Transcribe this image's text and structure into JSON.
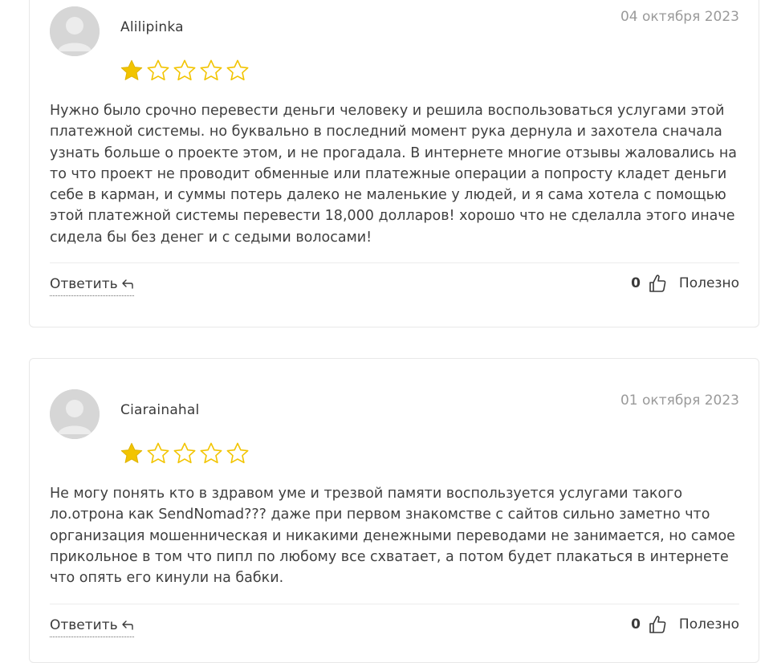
{
  "colors": {
    "star_filled": "#f2c400",
    "star_outline": "#f2c400",
    "date": "#9a9a9a",
    "text": "#3f3f3f"
  },
  "reviews": [
    {
      "author": "Alilipinka",
      "date": "04 октября 2023",
      "rating": 1,
      "max_rating": 5,
      "text": "Нужно было срочно перевести деньги человеку и решила воспользоваться услугами этой платежной системы. но буквально в последний момент рука дернула и захотела сначала узнать больше о проекте этом, и не прогадала. В интернете многие отзывы жаловались на то что проект не проводит обменные или платежные операции а попросту кладет деньги себе в карман, и суммы потерь далеко не маленькие у людей, и я сама хотела с помощью этой платежной системы перевести 18,000 долларов! хорошо что не сделалла этого иначе сидела бы без денег и с седыми волосами!",
      "reply_label": "Ответить",
      "reply_icon": "reply-arrow-icon",
      "likes": "0",
      "useful_label": "Полезно",
      "like_icon": "thumbs-up-icon"
    },
    {
      "author": "Ciarainahal",
      "date": "01 октября 2023",
      "rating": 1,
      "max_rating": 5,
      "text": "Не могу понять кто в здравом уме и трезвой памяти воспользуется услугами такого ло.отрона как SendNomad??? даже при первом знакомстве с сайтов сильно заметно что организация мошенническая и никакими денежными переводами не занимается, но самое прикольное в том что пипл по любому все схватает, а потом будет плакаться в интернете что опять его кинули на бабки.",
      "reply_label": "Ответить",
      "reply_icon": "reply-arrow-icon",
      "likes": "0",
      "useful_label": "Полезно",
      "like_icon": "thumbs-up-icon"
    }
  ]
}
